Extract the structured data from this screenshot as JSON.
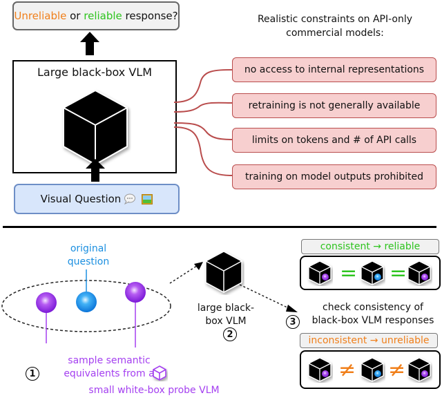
{
  "top": {
    "question_box": {
      "part1": "Unreliable",
      "part2": " or ",
      "part3": "reliable",
      "part4": " response?"
    },
    "vlm_box": {
      "title": "Large black-box VLM",
      "icon": "black-cube-icon"
    },
    "visual_question": {
      "label": "Visual Question",
      "icons": [
        "speech-bubble-icon",
        "image-icon"
      ]
    },
    "constraints": {
      "title_line1": "Realistic constraints on API-only",
      "title_line2": "commercial models:",
      "items": [
        "no access to internal representations",
        "retraining is not generally available",
        "limits on tokens and # of API calls",
        "training on model outputs prohibited"
      ]
    }
  },
  "bottom": {
    "original_question": {
      "line1": "original",
      "line2": "question"
    },
    "sample": {
      "line1": "sample semantic",
      "line2": "equivalents from a",
      "line3": "small white-box probe VLM"
    },
    "step1": "1",
    "step2": "2",
    "step3": "3",
    "large_vlm": {
      "line1": "large black-",
      "line2": "box VLM"
    },
    "check": {
      "line1": "check consistency of",
      "line2": "black-box VLM responses"
    },
    "consistent_label": "consistent → reliable",
    "inconsistent_label": "inconsistent → unreliable",
    "equal_symbol": "=",
    "not_equal_symbol": "≠"
  },
  "colors": {
    "orange": "#f07f1a",
    "green": "#2ec41e",
    "blue": "#1b8fe0",
    "purple": "#a43ff0",
    "constraint_border": "#b94c4c",
    "constraint_fill": "#f7cfcf",
    "question_fill": "#d8e6fb"
  }
}
